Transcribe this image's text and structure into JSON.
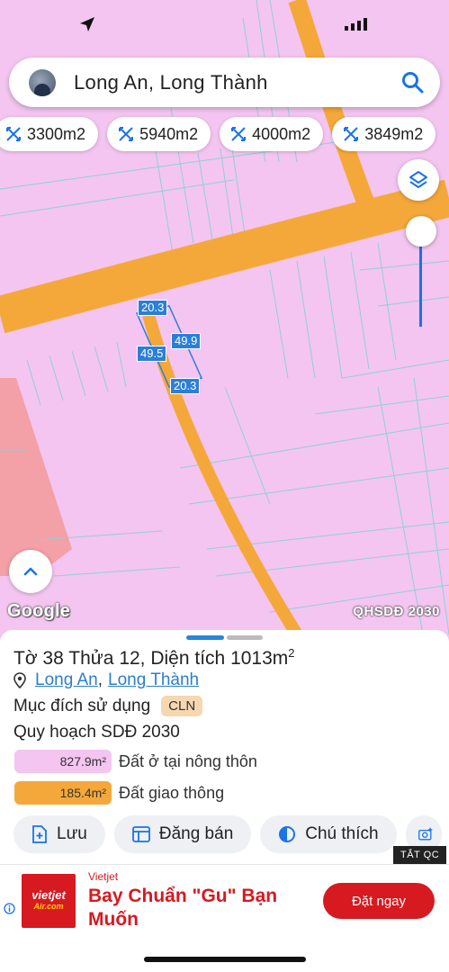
{
  "search": {
    "query": "Long An, Long Thành"
  },
  "chips": [
    {
      "label": "3300m2"
    },
    {
      "label": "5940m2"
    },
    {
      "label": "4000m2"
    },
    {
      "label": "3849m2"
    }
  ],
  "map": {
    "google_label": "Google",
    "plan_label": "QHSDĐ 2030",
    "dimensions": {
      "top": "20.3",
      "right": "49.9",
      "left": "49.5",
      "bottom": "20.3"
    },
    "colors": {
      "residential": "#f4c5f1",
      "road": "#f5a83a",
      "agri": "#f3a0a6",
      "parcel_lines": "#8fd0d6",
      "selection": "#2b7fd8"
    }
  },
  "parcel": {
    "title_prefix": "Tờ 38 Thửa 12, Diện tích ",
    "area": "1013m",
    "area_unit_sup": "2",
    "location_province": "Long An",
    "location_separator": ",",
    "location_district": "Long Thành",
    "purpose_label": "Mục đích sử dụng",
    "purpose_code": "CLN",
    "plan_label": "Quy hoạch SDĐ 2030",
    "zones": [
      {
        "area": "827.9m²",
        "label": "Đất ở tại nông thôn",
        "color": "#f4c5f1"
      },
      {
        "area": "185.4m²",
        "label": "Đất giao thông",
        "color": "#f5a83a"
      }
    ]
  },
  "actions": [
    {
      "label": "Lưu",
      "icon": "save-icon"
    },
    {
      "label": "Đăng bán",
      "icon": "listing-icon"
    },
    {
      "label": "Chú thích",
      "icon": "legend-icon"
    },
    {
      "label": "",
      "icon": "add-photo-icon"
    }
  ],
  "ad": {
    "close_label": "TẮT QC",
    "advertiser": "Vietjet",
    "logo_line1": "vietjet",
    "logo_line2": "Air.com",
    "headline": "Bay Chuẩn \"Gu\" Bạn Muốn",
    "cta": "Đặt ngay",
    "brand_color": "#d71920"
  }
}
